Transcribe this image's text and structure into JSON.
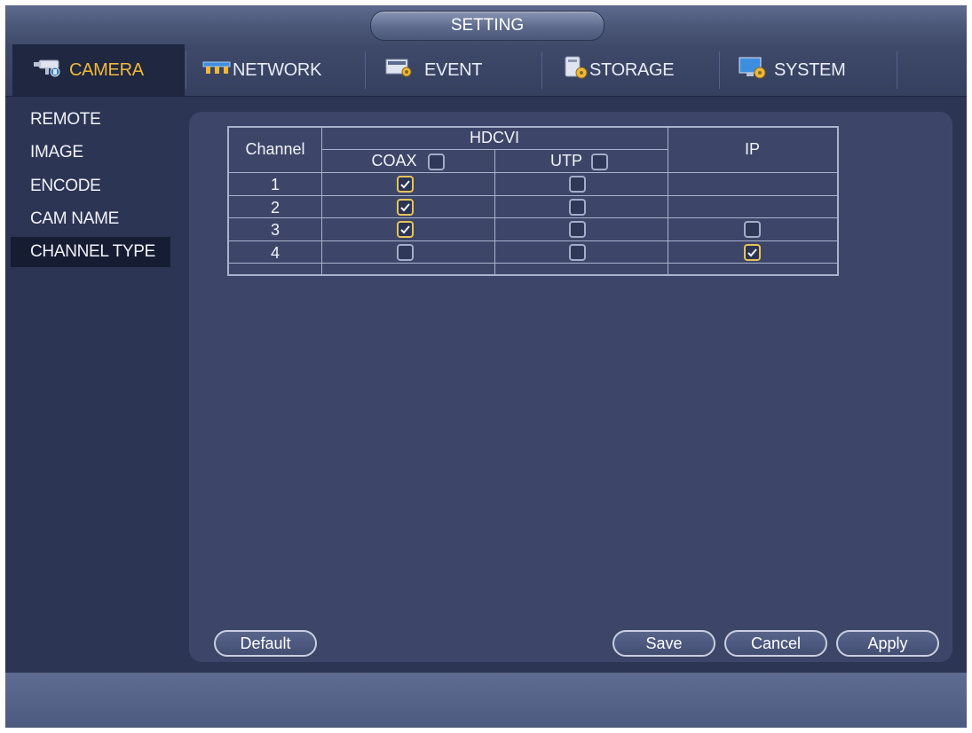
{
  "window": {
    "title": "SETTING"
  },
  "tabs": [
    {
      "label": "CAMERA",
      "icon": "camera-icon",
      "active": true
    },
    {
      "label": "NETWORK",
      "icon": "network-icon",
      "active": false
    },
    {
      "label": "EVENT",
      "icon": "event-icon",
      "active": false
    },
    {
      "label": "STORAGE",
      "icon": "storage-icon",
      "active": false
    },
    {
      "label": "SYSTEM",
      "icon": "system-icon",
      "active": false
    }
  ],
  "sidebar": {
    "items": [
      {
        "label": "REMOTE",
        "active": false
      },
      {
        "label": "IMAGE",
        "active": false
      },
      {
        "label": "ENCODE",
        "active": false
      },
      {
        "label": "CAM NAME",
        "active": false
      },
      {
        "label": "CHANNEL TYPE",
        "active": true
      }
    ]
  },
  "table": {
    "header": {
      "channel": "Channel",
      "hdcvi": "HDCVI",
      "coax": "COAX",
      "utp": "UTP",
      "ip": "IP"
    },
    "header_checks": {
      "coax": false,
      "utp": false
    },
    "rows": [
      {
        "channel": "1",
        "coax": true,
        "utp": false,
        "ip": null
      },
      {
        "channel": "2",
        "coax": true,
        "utp": false,
        "ip": null
      },
      {
        "channel": "3",
        "coax": true,
        "utp": false,
        "ip": false
      },
      {
        "channel": "4",
        "coax": false,
        "utp": false,
        "ip": true
      }
    ]
  },
  "buttons": {
    "default": "Default",
    "save": "Save",
    "cancel": "Cancel",
    "apply": "Apply"
  },
  "colors": {
    "active_tab_text": "#f0b83a",
    "checked_border": "#e6c35a"
  }
}
